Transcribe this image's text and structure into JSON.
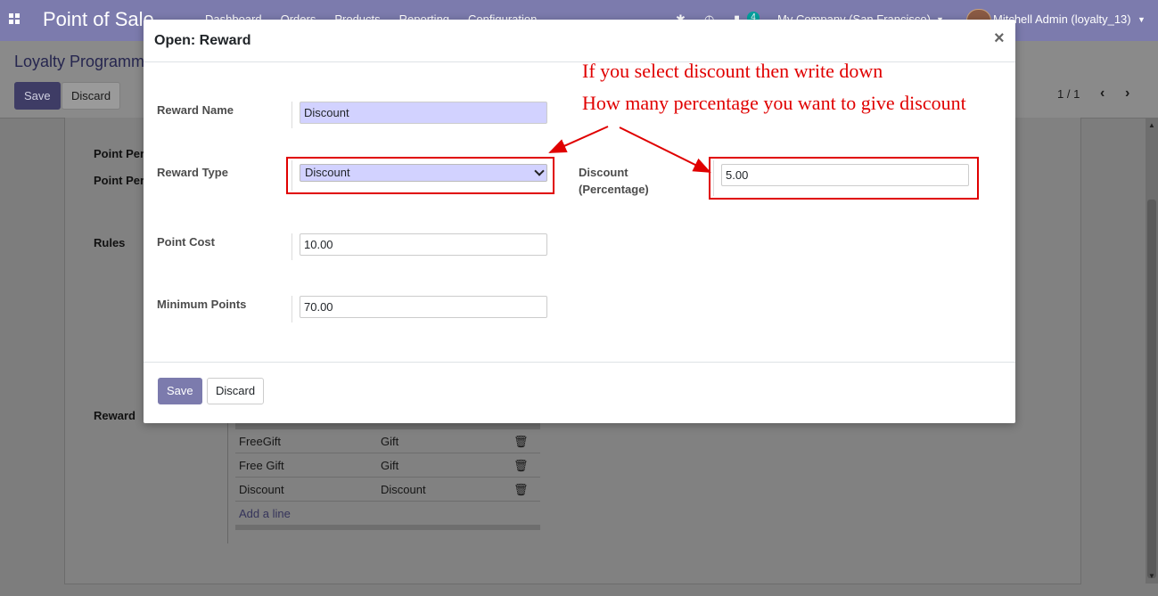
{
  "navbar": {
    "app_title": "Point of Sale",
    "menu": [
      "Dashboard",
      "Orders",
      "Products",
      "Reporting",
      "Configuration"
    ],
    "chat_count": "4",
    "company": "My Company (San Francisco)",
    "user": "Mitchell Admin (loyalty_13)"
  },
  "control_panel": {
    "breadcrumb": "Loyalty Programme",
    "save_label": "Save",
    "discard_label": "Discard",
    "pager": "1 / 1"
  },
  "background_form": {
    "labels": [
      "Point Per",
      "Point Per",
      "Rules",
      "Reward"
    ],
    "rewards": [
      {
        "name": "FreeGift",
        "type": "Gift"
      },
      {
        "name": "Free Gift",
        "type": "Gift"
      },
      {
        "name": "Discount",
        "type": "Discount"
      }
    ],
    "add_line": "Add a line"
  },
  "modal": {
    "title": "Open: Reward",
    "close_symbol": "×",
    "fields": {
      "reward_name": {
        "label": "Reward Name",
        "value": "Discount"
      },
      "reward_type": {
        "label": "Reward Type",
        "value": "Discount"
      },
      "point_cost": {
        "label": "Point Cost",
        "value": "10.00"
      },
      "minimum_points": {
        "label": "Minimum Points",
        "value": "70.00"
      },
      "discount_percentage": {
        "label_line1": "Discount",
        "label_line2": "(Percentage)",
        "value": "5.00"
      }
    },
    "save_label": "Save",
    "discard_label": "Discard"
  },
  "annotations": {
    "line1": "If you select discount then write down",
    "line2": "How many percentage you want to give discount",
    "color": "#e00000"
  },
  "colors": {
    "brand": "#7c7bad",
    "required_field": "#d2d2ff"
  }
}
